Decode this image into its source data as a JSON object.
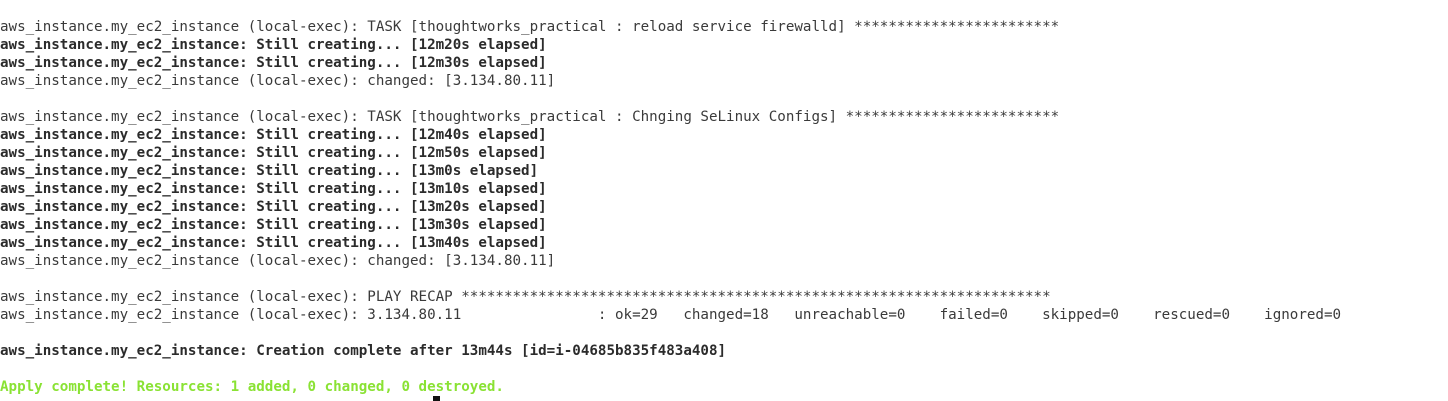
{
  "terminal": {
    "lines": [
      {
        "text": "aws_instance.my_ec2_instance (local-exec): TASK [thoughtworks_practical : reload service firewalld] ************************",
        "style": "normal"
      },
      {
        "text": "aws_instance.my_ec2_instance: Still creating... [12m20s elapsed]",
        "style": "bold"
      },
      {
        "text": "aws_instance.my_ec2_instance: Still creating... [12m30s elapsed]",
        "style": "bold"
      },
      {
        "text": "aws_instance.my_ec2_instance (local-exec): changed: [3.134.80.11]",
        "style": "normal"
      },
      {
        "text": "",
        "style": "normal"
      },
      {
        "text": "aws_instance.my_ec2_instance (local-exec): TASK [thoughtworks_practical : Chnging SeLinux Configs] *************************",
        "style": "normal"
      },
      {
        "text": "aws_instance.my_ec2_instance: Still creating... [12m40s elapsed]",
        "style": "bold"
      },
      {
        "text": "aws_instance.my_ec2_instance: Still creating... [12m50s elapsed]",
        "style": "bold"
      },
      {
        "text": "aws_instance.my_ec2_instance: Still creating... [13m0s elapsed]",
        "style": "bold"
      },
      {
        "text": "aws_instance.my_ec2_instance: Still creating... [13m10s elapsed]",
        "style": "bold"
      },
      {
        "text": "aws_instance.my_ec2_instance: Still creating... [13m20s elapsed]",
        "style": "bold"
      },
      {
        "text": "aws_instance.my_ec2_instance: Still creating... [13m30s elapsed]",
        "style": "bold"
      },
      {
        "text": "aws_instance.my_ec2_instance: Still creating... [13m40s elapsed]",
        "style": "bold"
      },
      {
        "text": "aws_instance.my_ec2_instance (local-exec): changed: [3.134.80.11]",
        "style": "normal"
      },
      {
        "text": "",
        "style": "normal"
      },
      {
        "text": "aws_instance.my_ec2_instance (local-exec): PLAY RECAP *********************************************************************",
        "style": "normal"
      },
      {
        "text": "aws_instance.my_ec2_instance (local-exec): 3.134.80.11                : ok=29   changed=18   unreachable=0    failed=0    skipped=0    rescued=0    ignored=0",
        "style": "normal"
      },
      {
        "text": "",
        "style": "normal"
      },
      {
        "text": "aws_instance.my_ec2_instance: Creation complete after 13m44s [id=i-04685b835f483a408]",
        "style": "bold"
      },
      {
        "text": "",
        "style": "normal"
      },
      {
        "text": "Apply complete! Resources: 1 added, 0 changed, 0 destroyed.",
        "style": "green"
      }
    ],
    "colors": {
      "background": "#ffffff",
      "text": "#3a3a3a",
      "success": "#8ae234",
      "cursor": "#111111"
    }
  }
}
